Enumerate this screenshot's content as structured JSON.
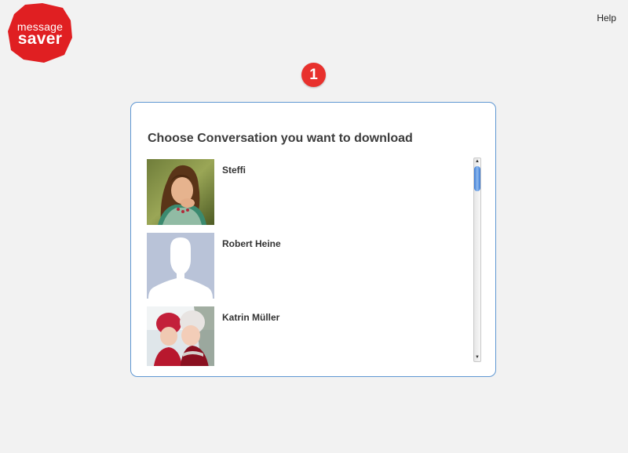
{
  "brand": {
    "line1": "message",
    "line2": "saver",
    "color": "#e01f22"
  },
  "header": {
    "help_label": "Help"
  },
  "step": {
    "number": "1",
    "color": "#e8312d"
  },
  "panel": {
    "title": "Choose Conversation you want to download",
    "border_color": "#5f97d2",
    "conversations": [
      {
        "name": "Steffi",
        "avatar": "photo-woman"
      },
      {
        "name": "Robert Heine",
        "avatar": "default-silhouette"
      },
      {
        "name": "Katrin Müller",
        "avatar": "photo-children-winter"
      }
    ]
  },
  "scrollbar": {
    "up_icon": "▲",
    "down_icon": "▼",
    "position_fraction": 0
  }
}
